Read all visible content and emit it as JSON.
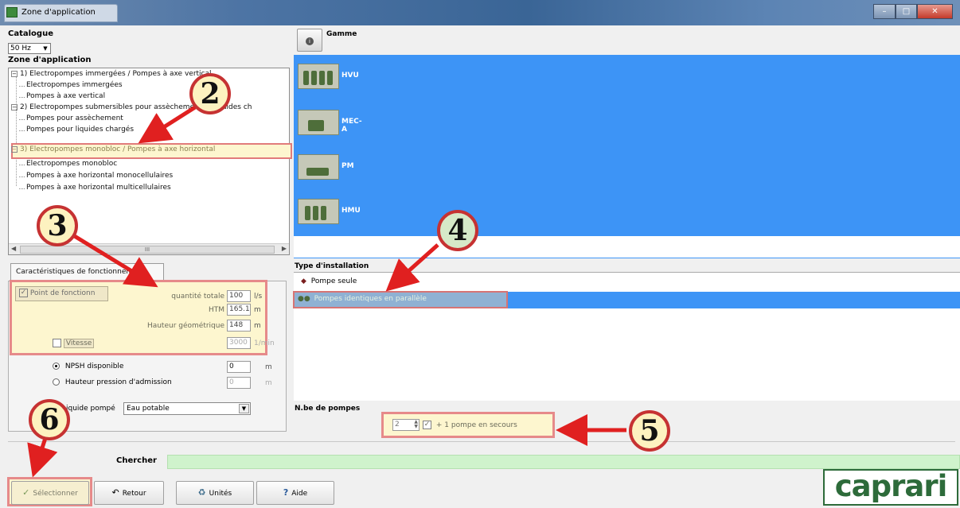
{
  "window": {
    "title": "Zone d'application"
  },
  "left": {
    "catalogue_label": "Catalogue",
    "catalogue_value": "50 Hz",
    "zone_label": "Zone d'application",
    "tree": [
      {
        "label": "1) Electropompes immergées / Pompes à axe vertical",
        "level": 0
      },
      {
        "label": "Electropompes immergées",
        "level": 1
      },
      {
        "label": "Pompes à axe vertical",
        "level": 1
      },
      {
        "label": "2) Electropompes submersibles pour assèchement et liquides ch",
        "level": 0
      },
      {
        "label": "Pompes pour assèchement",
        "level": 1
      },
      {
        "label": "Pompes pour liquides chargés",
        "level": 1
      },
      {
        "label": "3) Electropompes monobloc / Pompes à axe horizontal",
        "level": 0
      },
      {
        "label": "Electropompes monobloc",
        "level": 1
      },
      {
        "label": "Pompes à axe horizontal monocellulaires",
        "level": 1
      },
      {
        "label": "Pompes à axe horizontal multicellulaires",
        "level": 1
      }
    ],
    "scroll_thumb_label": "III",
    "tab_label": "Caractéristiques de fonctionnement",
    "point_label": "Point de fonctionn",
    "quantity_label": "quantité totale",
    "quantity_value": "100",
    "quantity_unit": "l/s",
    "htm_label": "HTM",
    "htm_value": "165.1",
    "htm_unit": "m",
    "hauteur_label": "Hauteur géométrique",
    "hauteur_value": "148",
    "hauteur_unit": "m",
    "vitesse_label": "Vitesse",
    "vitesse_value": "3000",
    "vitesse_unit": "1/min",
    "npsh_label": "NPSH disponible",
    "npsh_value": "0",
    "npsh_unit": "m",
    "hauteur_adm_label": "Hauteur pression d'admission",
    "hauteur_adm_value": "0",
    "hauteur_adm_unit": "m",
    "liquide_label": "Liquide pompé",
    "liquide_value": "Eau potable"
  },
  "right": {
    "gamme_label": "Gamme",
    "gammes": [
      "HVU",
      "MEC-A",
      "PM",
      "HMU"
    ],
    "installation_label": "Type d'installation",
    "installation_items": [
      "Pompe seule",
      "Pompes identiques en parallèle"
    ],
    "nb_label": "N.be de pompes",
    "nb_value": "2",
    "secours_label": "+ 1 pompe en secours"
  },
  "chercher_label": "Chercher",
  "buttons": {
    "select": "Sélectionner",
    "back": "Retour",
    "units": "Unités",
    "help": "Aide"
  },
  "logo": "caprari",
  "callouts": [
    "2",
    "3",
    "4",
    "5",
    "6"
  ],
  "accent_colors": {
    "selection_blue": "#3d94f6",
    "highlight_red": "#e68a8a",
    "arrow_red": "#e02020",
    "logo_green": "#2d6b3a"
  }
}
